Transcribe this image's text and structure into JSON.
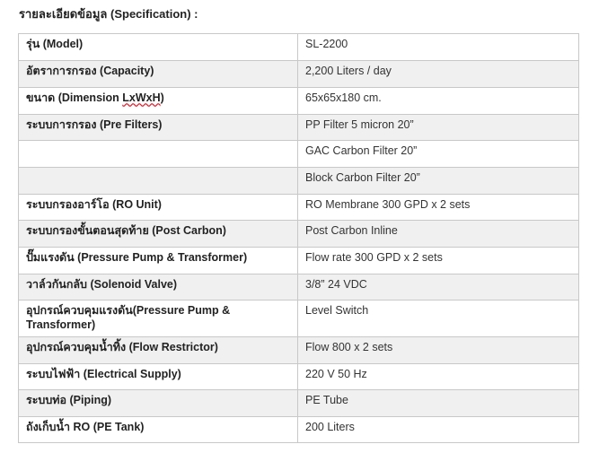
{
  "title": "รายละเอียดข้อมูล (Specification) :",
  "rows": [
    {
      "label": "รุ่น (Model)",
      "value": "SL-2200"
    },
    {
      "label": "อัตราการกรอง (Capacity)",
      "value": "2,200 Liters / day"
    },
    {
      "label_pre": "ขนาด (Dimension ",
      "label_sq": "LxWxH",
      "label_post": ")",
      "value": "65x65x180 cm."
    },
    {
      "label": "ระบบการกรอง (Pre Filters)",
      "value": "PP Filter 5 micron 20”"
    },
    {
      "label": "",
      "value": "GAC Carbon Filter 20”"
    },
    {
      "label": "",
      "value": "Block Carbon Filter 20”"
    },
    {
      "label": "ระบบกรองอาร์โอ (RO Unit)",
      "value": "RO Membrane 300 GPD x 2 sets"
    },
    {
      "label": "ระบบกรองขั้นตอนสุดท้าย (Post Carbon)",
      "value": "Post Carbon Inline"
    },
    {
      "label": "ปั๊มแรงดัน (Pressure Pump & Transformer)",
      "value": "Flow rate 300 GPD x 2 sets"
    },
    {
      "label": "วาล์วกันกลับ (Solenoid Valve)",
      "value": "3/8” 24 VDC"
    },
    {
      "label": "อุปกรณ์ควบคุมแรงดัน(Pressure Pump & Transformer)",
      "value": "Level Switch"
    },
    {
      "label": "อุปกรณ์ควบคุมน้ำทิ้ง (Flow Restrictor)",
      "value": "Flow 800 x 2 sets"
    },
    {
      "label": "ระบบไฟฟ้า (Electrical Supply)",
      "value": "220 V 50 Hz"
    },
    {
      "label": "ระบบท่อ (Piping)",
      "value": "PE Tube"
    },
    {
      "label": "ถังเก็บน้ำ RO (PE Tank)",
      "value": "200 Liters"
    }
  ]
}
